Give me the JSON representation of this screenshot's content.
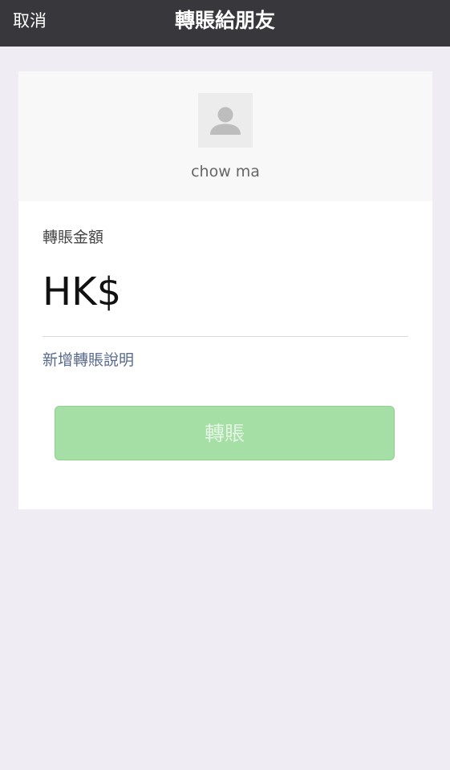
{
  "nav": {
    "cancel_label": "取消",
    "title": "轉賬給朋友"
  },
  "recipient": {
    "name": "chow ma",
    "avatar_icon": "user-silhouette-icon"
  },
  "amount": {
    "label": "轉賬金額",
    "currency": "HK$",
    "value": ""
  },
  "note": {
    "add_label": "新增轉賬說明"
  },
  "actions": {
    "transfer_label": "轉賬"
  },
  "colors": {
    "nav_background": "#38373c",
    "page_background": "#efedf3",
    "button_background": "#a5dfa6",
    "link_color": "#586a8c"
  }
}
